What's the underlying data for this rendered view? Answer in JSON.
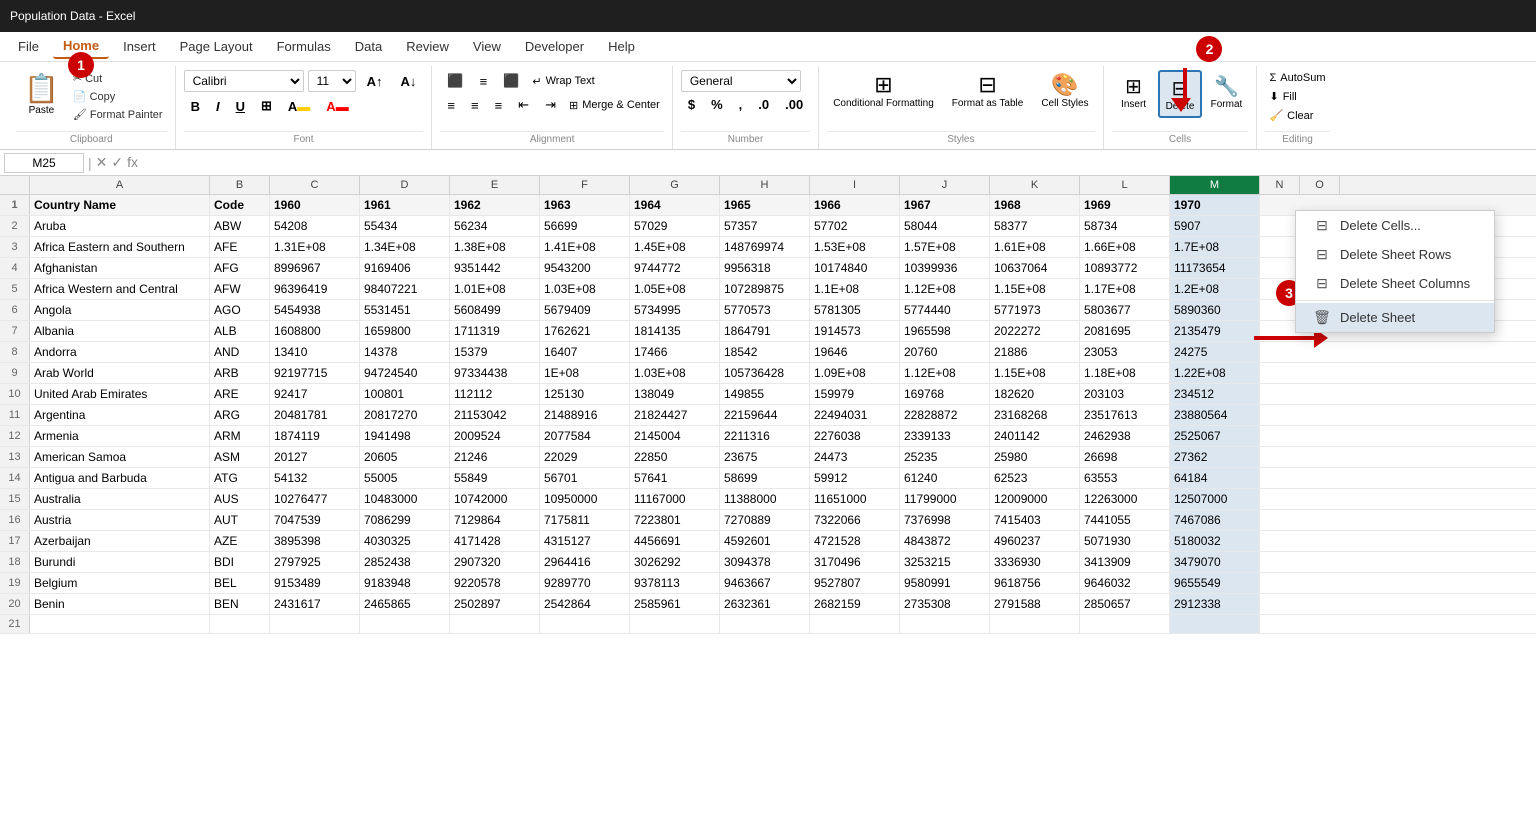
{
  "titleBar": {
    "text": "Population Data - Excel"
  },
  "menuBar": {
    "items": [
      {
        "label": "File",
        "active": false
      },
      {
        "label": "Home",
        "active": true
      },
      {
        "label": "Insert",
        "active": false
      },
      {
        "label": "Page Layout",
        "active": false
      },
      {
        "label": "Formulas",
        "active": false
      },
      {
        "label": "Data",
        "active": false
      },
      {
        "label": "Review",
        "active": false
      },
      {
        "label": "View",
        "active": false
      },
      {
        "label": "Developer",
        "active": false
      },
      {
        "label": "Help",
        "active": false
      }
    ]
  },
  "ribbon": {
    "clipboard": {
      "label": "Clipboard",
      "paste": "Paste",
      "cut": "✂ Cut",
      "copy": "Copy",
      "formatPainter": "Format Painter"
    },
    "font": {
      "label": "Font",
      "fontName": "Calibri",
      "fontSize": "11",
      "bold": "B",
      "italic": "I",
      "underline": "U"
    },
    "alignment": {
      "label": "Alignment",
      "wrapText": "Wrap Text",
      "mergeCenter": "Merge & Center"
    },
    "number": {
      "label": "Number",
      "format": "General"
    },
    "styles": {
      "label": "Styles",
      "conditional": "Conditional\nFormatting",
      "formatAsTable": "Format as\nTable",
      "cellStyles": "Cell\nStyles"
    },
    "cells": {
      "label": "Cells",
      "insert": "Insert",
      "delete": "Delete",
      "format": "Format"
    },
    "editing": {
      "label": "Editing",
      "autoSum": "AutoSum",
      "fill": "Fill",
      "clear": "Clear"
    }
  },
  "formulaBar": {
    "cellRef": "M25",
    "formula": ""
  },
  "columnHeaders": [
    "A",
    "B",
    "C",
    "D",
    "E",
    "F",
    "G",
    "H",
    "I",
    "J",
    "K",
    "L",
    "M",
    "N",
    "O"
  ],
  "tableHeaders": [
    "Country Name",
    "Code",
    "1960",
    "1961",
    "1962",
    "1963",
    "1964",
    "1965",
    "1966",
    "1967",
    "1968",
    "1969",
    "1970"
  ],
  "tableData": [
    [
      "Aruba",
      "ABW",
      "54208",
      "55434",
      "56234",
      "56699",
      "57029",
      "57357",
      "57702",
      "58044",
      "58377",
      "58734",
      "5907"
    ],
    [
      "Africa Eastern and Southern",
      "AFE",
      "1.31E+08",
      "1.34E+08",
      "1.38E+08",
      "1.41E+08",
      "1.45E+08",
      "148769974",
      "1.53E+08",
      "1.57E+08",
      "1.61E+08",
      "1.66E+08",
      "1.7E+08"
    ],
    [
      "Afghanistan",
      "AFG",
      "8996967",
      "9169406",
      "9351442",
      "9543200",
      "9744772",
      "9956318",
      "10174840",
      "10399936",
      "10637064",
      "10893772",
      "11173654"
    ],
    [
      "Africa Western and Central",
      "AFW",
      "96396419",
      "98407221",
      "1.01E+08",
      "1.03E+08",
      "1.05E+08",
      "107289875",
      "1.1E+08",
      "1.12E+08",
      "1.15E+08",
      "1.17E+08",
      "1.2E+08"
    ],
    [
      "Angola",
      "AGO",
      "5454938",
      "5531451",
      "5608499",
      "5679409",
      "5734995",
      "5770573",
      "5781305",
      "5774440",
      "5771973",
      "5803677",
      "5890360"
    ],
    [
      "Albania",
      "ALB",
      "1608800",
      "1659800",
      "1711319",
      "1762621",
      "1814135",
      "1864791",
      "1914573",
      "1965598",
      "2022272",
      "2081695",
      "2135479"
    ],
    [
      "Andorra",
      "AND",
      "13410",
      "14378",
      "15379",
      "16407",
      "17466",
      "18542",
      "19646",
      "20760",
      "21886",
      "23053",
      "24275"
    ],
    [
      "Arab World",
      "ARB",
      "92197715",
      "94724540",
      "97334438",
      "1E+08",
      "1.03E+08",
      "105736428",
      "1.09E+08",
      "1.12E+08",
      "1.15E+08",
      "1.18E+08",
      "1.22E+08"
    ],
    [
      "United Arab Emirates",
      "ARE",
      "92417",
      "100801",
      "112112",
      "125130",
      "138049",
      "149855",
      "159979",
      "169768",
      "182620",
      "203103",
      "234512"
    ],
    [
      "Argentina",
      "ARG",
      "20481781",
      "20817270",
      "21153042",
      "21488916",
      "21824427",
      "22159644",
      "22494031",
      "22828872",
      "23168268",
      "23517613",
      "23880564"
    ],
    [
      "Armenia",
      "ARM",
      "1874119",
      "1941498",
      "2009524",
      "2077584",
      "2145004",
      "2211316",
      "2276038",
      "2339133",
      "2401142",
      "2462938",
      "2525067"
    ],
    [
      "American Samoa",
      "ASM",
      "20127",
      "20605",
      "21246",
      "22029",
      "22850",
      "23675",
      "24473",
      "25235",
      "25980",
      "26698",
      "27362"
    ],
    [
      "Antigua and Barbuda",
      "ATG",
      "54132",
      "55005",
      "55849",
      "56701",
      "57641",
      "58699",
      "59912",
      "61240",
      "62523",
      "63553",
      "64184"
    ],
    [
      "Australia",
      "AUS",
      "10276477",
      "10483000",
      "10742000",
      "10950000",
      "11167000",
      "11388000",
      "11651000",
      "11799000",
      "12009000",
      "12263000",
      "12507000"
    ],
    [
      "Austria",
      "AUT",
      "7047539",
      "7086299",
      "7129864",
      "7175811",
      "7223801",
      "7270889",
      "7322066",
      "7376998",
      "7415403",
      "7441055",
      "7467086"
    ],
    [
      "Azerbaijan",
      "AZE",
      "3895398",
      "4030325",
      "4171428",
      "4315127",
      "4456691",
      "4592601",
      "4721528",
      "4843872",
      "4960237",
      "5071930",
      "5180032"
    ],
    [
      "Burundi",
      "BDI",
      "2797925",
      "2852438",
      "2907320",
      "2964416",
      "3026292",
      "3094378",
      "3170496",
      "3253215",
      "3336930",
      "3413909",
      "3479070"
    ],
    [
      "Belgium",
      "BEL",
      "9153489",
      "9183948",
      "9220578",
      "9289770",
      "9378113",
      "9463667",
      "9527807",
      "9580991",
      "9618756",
      "9646032",
      "9655549"
    ],
    [
      "Benin",
      "BEN",
      "2431617",
      "2465865",
      "2502897",
      "2542864",
      "2585961",
      "2632361",
      "2682159",
      "2735308",
      "2791588",
      "2850657",
      "2912338"
    ]
  ],
  "dropdown": {
    "items": [
      {
        "label": "Delete Cells...",
        "icon": "⊟"
      },
      {
        "label": "Delete Sheet Rows",
        "icon": "⊟"
      },
      {
        "label": "Delete Sheet Columns",
        "icon": "⊟"
      },
      {
        "label": "Delete Sheet",
        "icon": "🗑",
        "highlighted": true
      }
    ]
  },
  "badges": {
    "badge1": "1",
    "badge2": "2",
    "badge3": "3"
  }
}
